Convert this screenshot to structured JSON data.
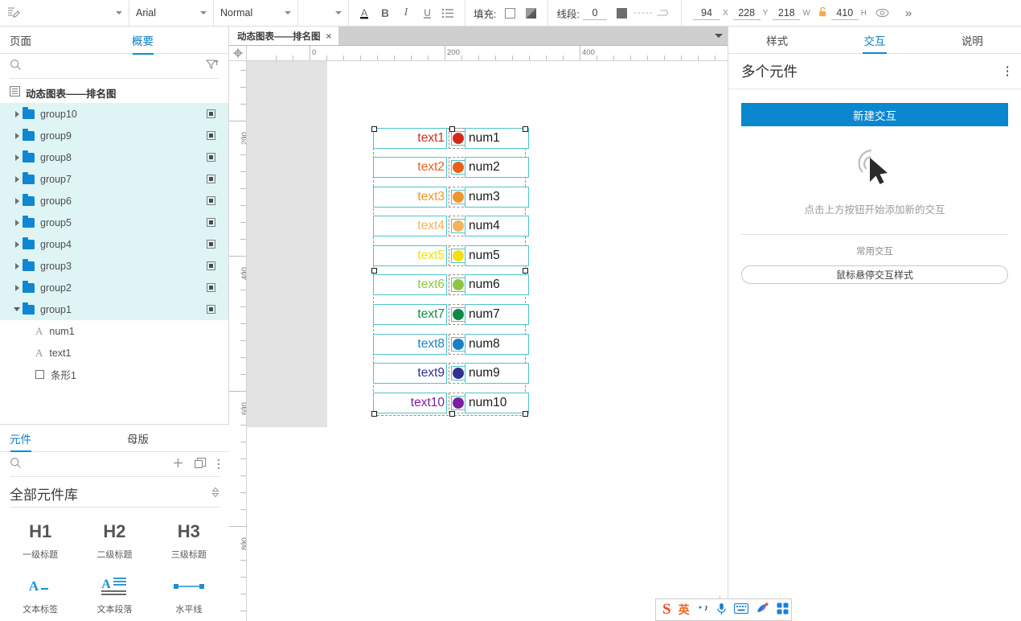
{
  "toolbar": {
    "style_combo": {
      "icon": "style-brush-icon",
      "value": ""
    },
    "font_combo": {
      "value": "Arial"
    },
    "weight_combo": {
      "value": "Normal"
    },
    "size_combo": {
      "value": ""
    },
    "format_icons": [
      {
        "name": "font-color-icon",
        "glyph": "A"
      },
      {
        "name": "bold-icon",
        "glyph": "B"
      },
      {
        "name": "italic-icon",
        "glyph": "I"
      },
      {
        "name": "underline-icon",
        "glyph": "U"
      },
      {
        "name": "list-icon",
        "glyph": "≡"
      }
    ],
    "fill_label": "填充:",
    "line_label": "线段:",
    "line_width": "0",
    "fields": [
      {
        "value": "94",
        "axis": "X"
      },
      {
        "value": "228",
        "axis": "Y"
      },
      {
        "value": "218",
        "axis": "W"
      },
      {
        "value": "410",
        "axis": "H"
      }
    ],
    "lock_icon": "unlock-icon",
    "eye_icon": "visibility-icon",
    "more_icon": "chevron-double-right-icon"
  },
  "left_panel": {
    "tabs": [
      {
        "label": "页面",
        "active": false
      },
      {
        "label": "概要",
        "active": true
      }
    ],
    "search_placeholder": "",
    "filter_icon": "filter-icon",
    "root": {
      "label": "动态图表——排名图",
      "icon": "page-icon"
    },
    "groups": [
      {
        "label": "group10",
        "expanded": false,
        "selected": true
      },
      {
        "label": "group9",
        "expanded": false,
        "selected": true
      },
      {
        "label": "group8",
        "expanded": false,
        "selected": true
      },
      {
        "label": "group7",
        "expanded": false,
        "selected": true
      },
      {
        "label": "group6",
        "expanded": false,
        "selected": true
      },
      {
        "label": "group5",
        "expanded": false,
        "selected": true
      },
      {
        "label": "group4",
        "expanded": false,
        "selected": true
      },
      {
        "label": "group3",
        "expanded": false,
        "selected": true
      },
      {
        "label": "group2",
        "expanded": false,
        "selected": true
      },
      {
        "label": "group1",
        "expanded": true,
        "selected": true
      }
    ],
    "children": [
      {
        "label": "num1",
        "icon": "text-icon"
      },
      {
        "label": "text1",
        "icon": "text-icon"
      },
      {
        "label": "条形1",
        "icon": "rectangle-icon"
      }
    ]
  },
  "library": {
    "tabs": [
      {
        "label": "元件",
        "active": true
      },
      {
        "label": "母版",
        "active": false
      }
    ],
    "search_placeholder": "",
    "add_icon": "plus-icon",
    "copy_icon": "duplicate-icon",
    "more_icon": "kebab-icon",
    "selected_library": "全部元件库",
    "items": [
      {
        "glyph": "H1",
        "caption": "一级标题",
        "icon": "heading1-icon"
      },
      {
        "glyph": "H2",
        "caption": "二级标题",
        "icon": "heading2-icon"
      },
      {
        "glyph": "H3",
        "caption": "三级标题",
        "icon": "heading3-icon"
      },
      {
        "glyph": "A",
        "caption": "文本标签",
        "icon": "text-label-icon"
      },
      {
        "glyph": "A",
        "caption": "文本段落",
        "icon": "text-paragraph-icon"
      },
      {
        "glyph": "—",
        "caption": "水平线",
        "icon": "horizontal-line-icon"
      }
    ]
  },
  "canvas": {
    "page_tab": "动态图表——排名图",
    "close_label": "×",
    "ruler_h_marks": [
      "0",
      "200",
      "400"
    ],
    "ruler_v_marks": [
      "200",
      "400",
      "600",
      "800"
    ],
    "rows": [
      {
        "text": "text1",
        "num": "num1",
        "color": "#d22b1e"
      },
      {
        "text": "text2",
        "num": "num2",
        "color": "#e8601c"
      },
      {
        "text": "text3",
        "num": "num3",
        "color": "#f0962d"
      },
      {
        "text": "text4",
        "num": "num4",
        "color": "#f3b35a"
      },
      {
        "text": "text5",
        "num": "num5",
        "color": "#f2e013"
      },
      {
        "text": "text6",
        "num": "num6",
        "color": "#8ec63f"
      },
      {
        "text": "text7",
        "num": "num7",
        "color": "#0e8a46"
      },
      {
        "text": "text8",
        "num": "num8",
        "color": "#1b7fc4"
      },
      {
        "text": "text9",
        "num": "num9",
        "color": "#2e3192"
      },
      {
        "text": "text10",
        "num": "num10",
        "color": "#7b1fa2"
      }
    ]
  },
  "right_panel": {
    "tabs": [
      {
        "label": "样式",
        "active": false
      },
      {
        "label": "交互",
        "active": true
      },
      {
        "label": "说明",
        "active": false
      }
    ],
    "title": "多个元件",
    "menu_icon": "kebab-icon",
    "new_button": "新建交互",
    "empty_icon": "click-cursor-icon",
    "empty_text": "点击上方按钮开始添加新的交互",
    "common_label": "常用交互",
    "common_action": "鼠标悬停交互样式"
  },
  "ime": {
    "logo": "S",
    "mode": "英",
    "punct_icon": "punctuation-icon",
    "mic_icon": "microphone-icon",
    "keyboard_icon": "keyboard-icon",
    "skin_icon": "skin-icon",
    "apps_icon": "apps-icon"
  }
}
